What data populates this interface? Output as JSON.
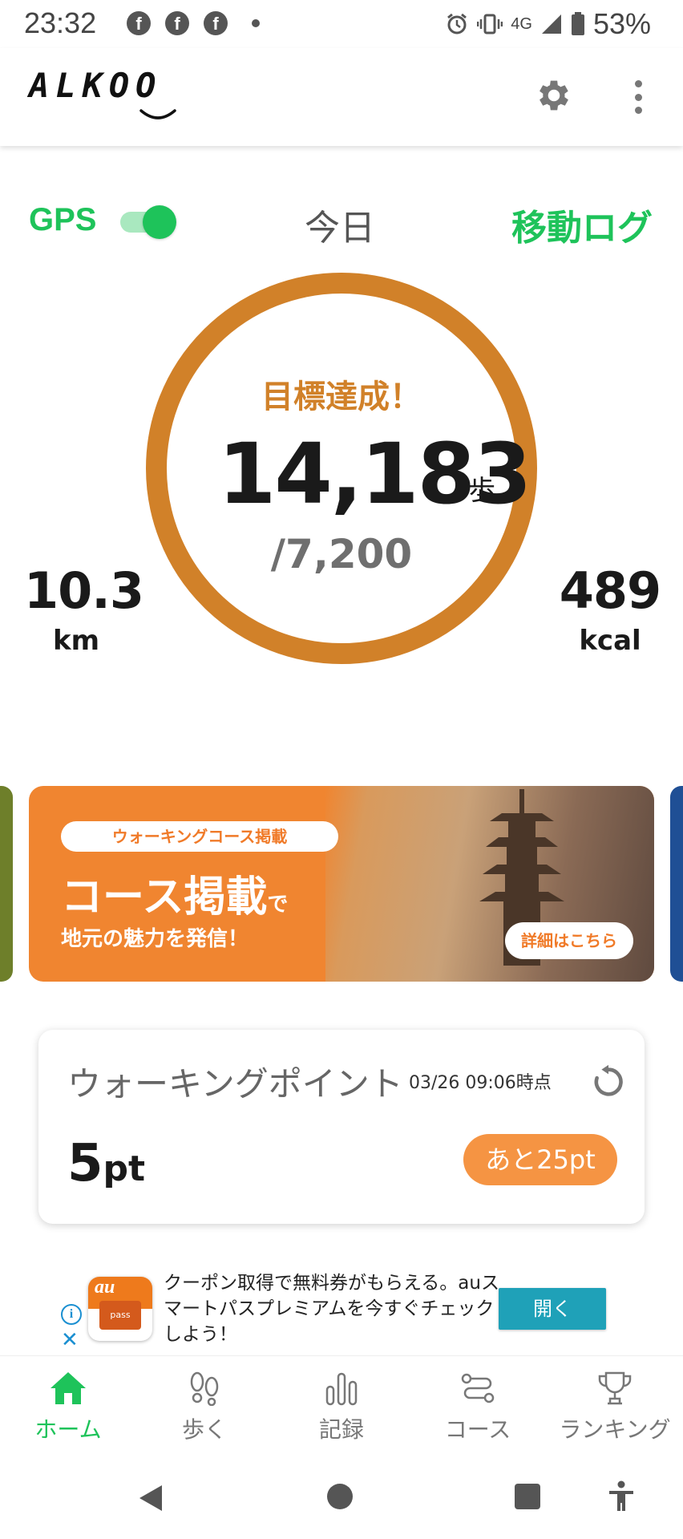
{
  "status_bar": {
    "time": "23:32",
    "notification_icons": [
      "facebook-icon",
      "facebook-icon",
      "facebook-icon"
    ],
    "network": "4G",
    "battery": "53%"
  },
  "app_bar": {
    "logo": "ALKOO",
    "actions": [
      "gear-icon",
      "more-vert-icon"
    ]
  },
  "header": {
    "gps_label": "GPS",
    "gps_enabled": true,
    "period_label": "今日",
    "move_log_label": "移動ログ"
  },
  "progress": {
    "status_text": "目標達成！",
    "steps": "14,183",
    "steps_unit": "歩",
    "target": "/7,200",
    "completion_fraction": 1.0
  },
  "stats": {
    "distance_value": "10.3",
    "distance_unit": "km",
    "calories_value": "489",
    "calories_unit": "kcal"
  },
  "banner": {
    "pill": "ウォーキングコース掲載",
    "title_main": "コース掲載",
    "title_suffix": "で",
    "subtitle": "地元の魅力を発信！",
    "detail_button": "詳細はこちら"
  },
  "points_card": {
    "title": "ウォーキングポイント",
    "timestamp": "03/26 09:06時点",
    "points_value": "5",
    "points_unit": "pt",
    "remaining": "あと25pt"
  },
  "ad": {
    "app_name": "au",
    "app_card": "pass",
    "text": "クーポン取得で無料券がもらえる。auスマートパスプレミアムを今すぐチェックしよう！",
    "open_button": "開く"
  },
  "bottom_nav": {
    "items": [
      {
        "label": "ホーム",
        "icon": "home-icon",
        "active": true
      },
      {
        "label": "歩く",
        "icon": "footprints-icon",
        "active": false
      },
      {
        "label": "記録",
        "icon": "bar-chart-icon",
        "active": false
      },
      {
        "label": "コース",
        "icon": "route-icon",
        "active": false
      },
      {
        "label": "ランキング",
        "icon": "trophy-icon",
        "active": false
      }
    ]
  },
  "colors": {
    "accent_green": "#1ec35a",
    "ring_orange": "#d18129",
    "banner_orange": "#f08530",
    "pill_orange": "#f59443",
    "ad_button": "#1fa1b8"
  }
}
